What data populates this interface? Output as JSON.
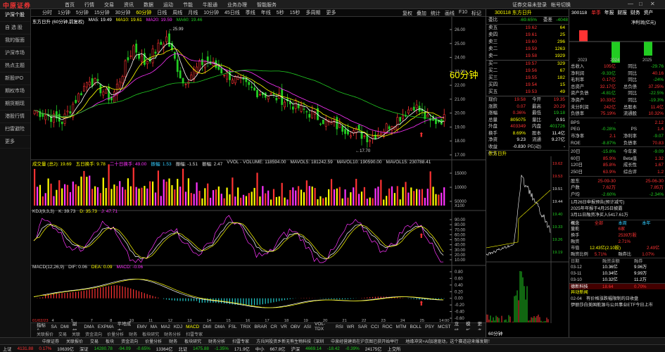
{
  "app": {
    "logo": "中原证券",
    "menu": [
      "首页",
      "行情",
      "交易",
      "资讯",
      "数据",
      "运动",
      "节能",
      "牛股通",
      "业务办理",
      "智能服务"
    ],
    "right": [
      "证券交易未登录",
      "帐号切换"
    ]
  },
  "sidebar": [
    "沪深个股",
    "自 选 股",
    "我的版面",
    "沪深市场",
    "热点主题",
    "新股IPO",
    "期权市场",
    "期货期现",
    "港股行情",
    "扫雷避险",
    "更多"
  ],
  "periods": [
    "分时",
    "1分钟",
    "5分钟",
    "15分钟",
    "30分钟",
    "60分钟",
    "日线",
    "周线",
    "月线",
    "10分钟",
    "45日线",
    "季线",
    "年线",
    "5秒",
    "15秒",
    "多周期",
    "更多"
  ],
  "active_period": "60分钟",
  "chart_tools": [
    "复权",
    "叠加",
    "统计",
    "画线",
    "F10",
    "标记"
  ],
  "main": {
    "title": "东方日升 (60分钟,前复权)",
    "ma": [
      {
        "label": "MA5: 19.49",
        "color": "#ffffff"
      },
      {
        "label": "MA10: 19.61",
        "color": "#ffff00"
      },
      {
        "label": "MA20: 19.59",
        "color": "#ff33ff"
      },
      {
        "label": "MA60: 19.46",
        "color": "#22cc22"
      }
    ],
    "watermark": "60分钟",
    "high_label": "25.99",
    "low_label": "17.70",
    "y_ticks": [
      "26.00",
      "25.00",
      "24.00",
      "23.00",
      "22.00",
      "21.00",
      "20.00",
      "19.00",
      "18.00",
      "17.00"
    ]
  },
  "vol": {
    "header": [
      {
        "t": "成交量 (总2): 19.69",
        "c": "#ffff00"
      },
      {
        "t": "五日换手: 9.78",
        "c": "#ffff00"
      },
      {
        "t": "二十日换手: 49.00",
        "c": "#ff33ff"
      },
      {
        "t": "振幅: 1.53",
        "c": "#3cf"
      },
      {
        "t": "振幅: -1.51",
        "c": "#ddd"
      },
      {
        "t": "振幅: 2.47",
        "c": "#ddd"
      },
      {
        "t": "VVOL - VOLUME: 118594.00",
        "c": "#ddd"
      },
      {
        "t": "MAVOL5: 181242.59",
        "c": "#ddd"
      },
      {
        "t": "MAVOL10: 190590.00",
        "c": "#ddd"
      },
      {
        "t": "MAVOL15: 230788.41",
        "c": "#ddd"
      }
    ],
    "y_ticks": [
      "15000",
      "10000",
      "50000"
    ],
    "unit": "X100"
  },
  "kdj": {
    "header": [
      {
        "t": "KDJ(9,3,3)",
        "c": "#ddd"
      },
      {
        "t": "K: 39.73",
        "c": "#ddd"
      },
      {
        "t": "D: 35.73",
        "c": "#ffff00"
      },
      {
        "t": "J: 47.71",
        "c": "#ff33ff"
      }
    ],
    "y_ticks": [
      "90.00",
      "80.00",
      "70.00",
      "60.00",
      "50.00",
      "40.00",
      "30.00",
      "20.00",
      "10.00"
    ]
  },
  "macd": {
    "header": [
      {
        "t": "MACD(12,26,9)",
        "c": "#ddd"
      },
      {
        "t": "DIF: 0.06",
        "c": "#ddd"
      },
      {
        "t": "DEA: 0.09",
        "c": "#ffff00"
      },
      {
        "t": "MACD: -0.06",
        "c": "#ff33ff"
      }
    ],
    "y_ticks": [
      "0.80",
      "0.60",
      "0.40",
      "0.20",
      "0.00",
      "-0.20",
      "-0.40",
      "-0.60"
    ]
  },
  "x_labels": [
    "01/02/23",
    "4",
    "5",
    "7",
    "8",
    "10",
    "11",
    "12",
    "13",
    "14",
    "15",
    "16",
    "17",
    "18",
    "19",
    "20",
    "21",
    "22",
    "23",
    "24",
    "25",
    "14:00"
  ],
  "indicators": [
    "指标A",
    "SA",
    "DMI",
    "副幅",
    "DMA",
    "EXPMA",
    "平地成本",
    "EMV",
    "MA",
    "MA2",
    "KDJ",
    "MACD",
    "DMI",
    "DMA",
    "FSL",
    "TRIX",
    "BRAR",
    "CR",
    "VR",
    "OBV",
    "ASI",
    "VOL-TDX",
    "RSI",
    "WR",
    "SAR",
    "CCI",
    "ROC",
    "MTM",
    "BOLL",
    "PSY",
    "MCST",
    "龙线",
    "模板",
    "更多"
  ],
  "active_indicator": "MACD",
  "bottom_tabs": [
    "关联报价",
    "交易",
    "关联",
    "资金流向",
    "价量分析",
    "财务",
    "板块研究",
    "财务分析",
    "扫雷专家"
  ],
  "quote": {
    "title": "300118 东方日升",
    "weibi": {
      "label": "委比",
      "v1": "-69.65%",
      "label2": "委差",
      "v2": "-4048"
    },
    "sells": [
      {
        "l": "卖五",
        "p": "19.62",
        "v": "64"
      },
      {
        "l": "卖四",
        "p": "19.61",
        "v": "25"
      },
      {
        "l": "卖三",
        "p": "19.60",
        "v": "296"
      },
      {
        "l": "卖二",
        "p": "19.59",
        "v": "1263"
      },
      {
        "l": "卖一",
        "p": "19.58",
        "v": "1929"
      }
    ],
    "buys": [
      {
        "l": "买一",
        "p": "19.57",
        "v": "329"
      },
      {
        "l": "买二",
        "p": "19.56",
        "v": "67"
      },
      {
        "l": "买三",
        "p": "19.55",
        "v": "182"
      },
      {
        "l": "买四",
        "p": "19.54",
        "v": "15"
      },
      {
        "l": "买五",
        "p": "19.53",
        "v": "49"
      }
    ],
    "stats": [
      {
        "a": "现价",
        "b": "19.58",
        "bc": "red",
        "c": "今开",
        "d": "19.35",
        "dc": "red"
      },
      {
        "a": "涨跌",
        "b": "0.07",
        "bc": "red",
        "c": "最高",
        "d": "20.29",
        "dc": "red"
      },
      {
        "a": "涨幅",
        "b": "0.36%",
        "bc": "red",
        "c": "最低",
        "d": "19.18",
        "dc": "green"
      },
      {
        "a": "总量",
        "b": "805075",
        "bc": "yellow",
        "c": "量比",
        "d": "0.91",
        "dc": "white"
      },
      {
        "a": "外盘",
        "b": "403349",
        "bc": "red",
        "c": "内盘",
        "d": "401726",
        "dc": "green"
      },
      {
        "a": "换手",
        "b": "8.69%",
        "bc": "yellow",
        "c": "股本",
        "d": "11.4亿",
        "dc": "white"
      },
      {
        "a": "净资",
        "b": "9.23",
        "bc": "white",
        "c": "流通",
        "d": "9.27亿",
        "dc": "white"
      },
      {
        "a": "收益(一)",
        "b": "-0.830",
        "bc": "white",
        "c": "PE(动)",
        "d": "-",
        "dc": "white"
      }
    ],
    "name": "东方日升",
    "mini_ticks": [
      "19.62",
      "19.53",
      "19.51",
      "19.44",
      "19.40",
      "19.33",
      "19.26",
      "19.19"
    ],
    "time_tab": "60分钟"
  },
  "f10": {
    "code": "300118",
    "tabs": [
      "单季",
      "年报",
      "财报",
      "财务",
      "资产"
    ],
    "chart_title": "净利润(亿元)",
    "years": [
      "2023",
      "2024",
      "2025"
    ],
    "rows": [
      {
        "k": "总收入",
        "v": "105亿",
        "k2": "同比",
        "v2": "-29.76"
      },
      {
        "k": "净利润",
        "v": "-9.33亿",
        "k2": "同比",
        "v2": "40.16"
      },
      {
        "k": "毛利率",
        "v": "0.17亿",
        "k2": "同比",
        "v2": "-24%"
      },
      {
        "k": "总资产",
        "v": "32.17亿",
        "k2": "总负债",
        "v2": "37.25%"
      },
      {
        "k": "资产负债",
        "v": "-4.81亿",
        "k2": "同比",
        "v2": "-22.5%"
      },
      {
        "k": "净资产",
        "v": "10.33亿",
        "k2": "同比",
        "v2": "-19.3%"
      },
      {
        "k": "未分利润",
        "v": "242亿",
        "k2": "总股本",
        "v2": "11.4亿"
      },
      {
        "k": "负债率",
        "v": "75.19%",
        "k2": "流通股",
        "v2": "10.32%"
      }
    ],
    "rows2": [
      {
        "k": "BPS",
        "v": "-",
        "k2": "",
        "v2": "2.12"
      },
      {
        "k": "PEG",
        "v": "-0.28%",
        "k2": "PS",
        "v2": "1.4"
      },
      {
        "k": "市净率",
        "v": "2.1",
        "k2": "净利率",
        "v2": "-9.07"
      },
      {
        "k": "ROE",
        "v": "-8.87%",
        "k2": "负债率",
        "v2": "70.83"
      }
    ],
    "rows3": [
      {
        "k": "20日",
        "v": "-15.8%",
        "k2": "今年来",
        "v2": "-9.09"
      },
      {
        "k": "60日",
        "v": "85.9%",
        "k2": "Beta值",
        "v2": "1.32"
      },
      {
        "k": "120日",
        "v": "85.8%",
        "k2": "成长性",
        "v2": "1.67"
      },
      {
        "k": "250日",
        "v": "63.9%",
        "k2": "综合评",
        "v2": "1.2"
      }
    ],
    "rows4": [
      {
        "k": "股东",
        "v": "25-09-30",
        "k2": "",
        "v2": "25-06-30"
      },
      {
        "k": "户数",
        "v": "7.62万",
        "k2": "",
        "v2": "7.85万"
      },
      {
        "k": "户均",
        "v": "-2.60%",
        "k2": "",
        "v2": "-2.34%"
      }
    ],
    "notes": [
      "1月26日申报预告(预计减亏)",
      "2025年年报于4月25日披露",
      "3月11日融资净买入5417.61万"
    ],
    "concept": {
      "l": "概念",
      "tabs": [
        "全部",
        "本周",
        "本年"
      ]
    },
    "rank": [
      {
        "k": "量能",
        "v": "6家"
      },
      {
        "k": "换手",
        "v": "2539万股"
      },
      {
        "k": "融资",
        "v": "2.71%"
      }
    ],
    "fund_line": {
      "k": "市值",
      "v": "12.43亿(2.10股)",
      "v2": "2.49亿"
    },
    "ratio": {
      "k": "融资比例",
      "v": "5.71%",
      "k2": "融券比",
      "v2": "1.07%"
    },
    "table_hdr": [
      "日期",
      "融资余额",
      "融券"
    ],
    "table": [
      {
        "d": "03-12",
        "a": "10.36亿",
        "b": "9.96万"
      },
      {
        "d": "03-11",
        "a": "10.34亿",
        "b": "9.99万"
      },
      {
        "d": "03-10",
        "a": "10.32亿",
        "b": "11.2万"
      }
    ],
    "hot": {
      "name": "德新科技",
      "p": "18.64",
      "pct": "0.70%"
    },
    "news_hdr": "异动新闻",
    "news": [
      {
        "d": "02-04",
        "t": "有价格涨跌幅限制的日收盘"
      }
    ],
    "ticker": "伊丽莎白美国能源与公共事业ETF今日上市"
  },
  "info": [
    "中原证券",
    "关联报价",
    "交易",
    "板块",
    "资金流向",
    "价量分析",
    "财务",
    "板块研究",
    "财务分析",
    "扫雷专家",
    "方兵同投资乡新无熊生物科技（深圳",
    "中泉经营建商在沪京图已获开始举行",
    "地缘冲突+AI加速驱动，这个赛道迎来爆发期！"
  ],
  "status": [
    {
      "t": "上证",
      "c": "#ddd"
    },
    {
      "t": "4131.88",
      "c": "#f33"
    },
    {
      "t": "0.17%",
      "c": "#f33"
    },
    {
      "t": "10639亿",
      "c": "#ddd"
    },
    {
      "t": "深证",
      "c": "#ddd"
    },
    {
      "t": "14280.78",
      "c": "#2c2"
    },
    {
      "t": "-94.09",
      "c": "#2c2"
    },
    {
      "t": "-0.65%",
      "c": "#2c2"
    },
    {
      "t": "13364亿",
      "c": "#ddd"
    },
    {
      "t": "北证",
      "c": "#ddd"
    },
    {
      "t": "1475.88",
      "c": "#2c2"
    },
    {
      "t": "-1.35%",
      "c": "#2c2"
    },
    {
      "t": "171.9亿",
      "c": "#ddd"
    },
    {
      "t": "中小",
      "c": "#ddd"
    },
    {
      "t": "667.8亿",
      "c": "#ddd"
    },
    {
      "t": "沪深",
      "c": "#ddd"
    },
    {
      "t": "4669.14",
      "c": "#2c2"
    },
    {
      "t": "-18.42",
      "c": "#2c2"
    },
    {
      "t": "-0.39%",
      "c": "#2c2"
    },
    {
      "t": "24175亿",
      "c": "#ddd"
    },
    {
      "t": "上交所",
      "c": "#ddd"
    }
  ],
  "colors": {
    "up": "#ff3333",
    "down": "#22cc22",
    "ma5": "#ffffff",
    "ma10": "#ffff00",
    "ma20": "#ff33ff",
    "ma60": "#22cc22",
    "bg": "#000000"
  },
  "chart_data": [
    {
      "type": "candlestick",
      "series": [
        {
          "name": "MA5",
          "values": [
            19.49
          ]
        },
        {
          "name": "MA10",
          "values": [
            19.61
          ]
        },
        {
          "name": "MA20",
          "values": [
            19.59
          ]
        },
        {
          "name": "MA60",
          "values": [
            19.46
          ]
        }
      ],
      "ylim": [
        17,
        26
      ]
    },
    {
      "type": "bar",
      "series": [
        {
          "name": "成交量",
          "values": []
        }
      ]
    },
    {
      "type": "line",
      "series": [
        {
          "name": "K",
          "values": [
            39.73
          ]
        },
        {
          "name": "D",
          "values": [
            35.73
          ]
        },
        {
          "name": "J",
          "values": [
            47.71
          ]
        }
      ]
    },
    {
      "type": "line",
      "series": [
        {
          "name": "DIF",
          "values": [
            0.06
          ]
        },
        {
          "name": "DEA",
          "values": [
            0.09
          ]
        },
        {
          "name": "MACD",
          "values": [
            -0.06
          ]
        }
      ]
    }
  ]
}
